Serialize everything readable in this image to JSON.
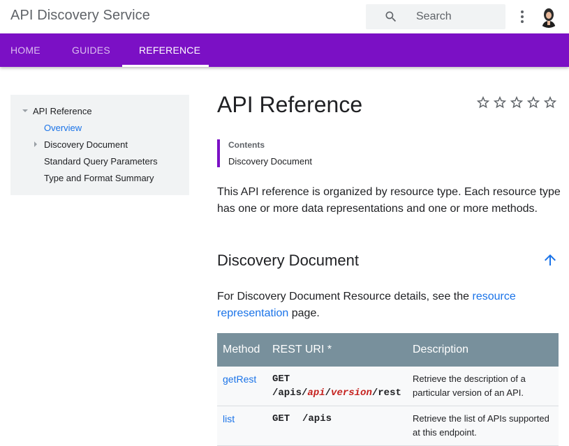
{
  "header": {
    "site_title": "API Discovery Service",
    "search_placeholder": "Search"
  },
  "nav": {
    "tabs": [
      {
        "label": "HOME",
        "active": false
      },
      {
        "label": "GUIDES",
        "active": false
      },
      {
        "label": "REFERENCE",
        "active": true
      }
    ]
  },
  "sidebar": {
    "items": [
      {
        "label": "API Reference",
        "expanded": true
      },
      {
        "label": "Overview",
        "active": true
      },
      {
        "label": "Discovery Document",
        "expandable": true
      },
      {
        "label": "Standard Query Parameters"
      },
      {
        "label": "Type and Format Summary"
      }
    ]
  },
  "main": {
    "title": "API Reference",
    "rating_stars": 5,
    "toc": {
      "title": "Contents",
      "items": [
        "Discovery Document"
      ]
    },
    "intro": "This API reference is organized by resource type. Each resource type has one or more data representations and one or more methods.",
    "section": {
      "heading": "Discovery Document",
      "para_prefix": "For Discovery Document Resource details, see the ",
      "para_link": "resource representation",
      "para_suffix": " page."
    },
    "table": {
      "headers": [
        "Method",
        "REST URI *",
        "Description"
      ],
      "rows": [
        {
          "method": "getRest",
          "verb": "GET",
          "uri_prefix": "/apis/",
          "uri_var1": "api",
          "uri_sep": "/",
          "uri_var2": "version",
          "uri_suffix": "/rest",
          "description": "Retrieve the description of a particular version of an API."
        },
        {
          "method": "list",
          "verb": "GET",
          "uri": "/apis",
          "description": "Retrieve the list of APIs supported at this endpoint."
        }
      ]
    }
  },
  "colors": {
    "brand_purple": "#7b10c5",
    "link_blue": "#1a73e8",
    "table_header": "#78909c",
    "uri_variable": "#c5221f"
  }
}
